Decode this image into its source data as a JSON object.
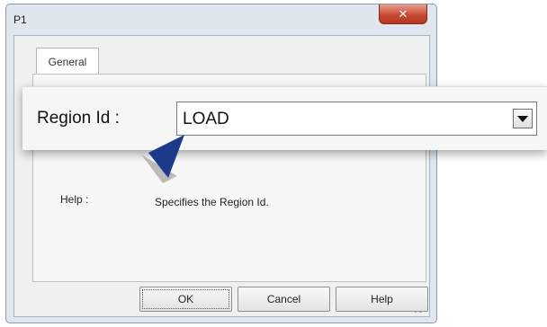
{
  "window": {
    "title": "P1",
    "close_glyph": "✕"
  },
  "tabs": [
    {
      "label": "General"
    }
  ],
  "field": {
    "label": "Region Id :",
    "value": "LOAD"
  },
  "help": {
    "label": "Help :",
    "text": "Specifies the Region Id."
  },
  "buttons": {
    "ok": "OK",
    "cancel": "Cancel",
    "help": "Help"
  },
  "colors": {
    "close_button": "#c84a32",
    "pointer_arrow": "#1c3a8c"
  },
  "icons": {
    "close": "close-icon",
    "dropdown": "chevron-down-icon",
    "pointer": "callout-pointer-icon",
    "grip": "resize-grip-icon"
  }
}
